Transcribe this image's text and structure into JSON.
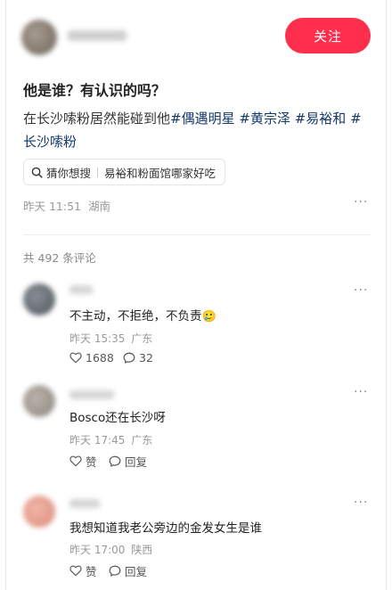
{
  "post": {
    "follow_label": "关注",
    "title": "他是谁？有认识的吗？",
    "body_line1": "在长沙嗦粉居然能碰到他",
    "tags": [
      "#偶遇明星",
      "#黄宗泽",
      "#易裕和",
      "#长沙嗦粉"
    ],
    "search_prefix": "猜你想搜",
    "search_query": "易裕和粉面馆哪家好吃",
    "date": "昨天 11:51",
    "location": "湖南",
    "more": "···"
  },
  "comments_header": "共 492 条评论",
  "comments": [
    {
      "text": "不主动，不拒绝，不负责",
      "emoji": "🥲",
      "date": "昨天 15:35",
      "location": "广东",
      "likes": "1688",
      "replies": "32",
      "more": "···"
    },
    {
      "text": "Bosco还在长沙呀",
      "date": "昨天 17:45",
      "location": "广东",
      "likes": "赞",
      "replies": "回复",
      "more": "···"
    },
    {
      "text": "我想知道我老公旁边的金发女生是谁",
      "date": "昨天 17:00",
      "location": "陕西",
      "likes": "赞",
      "replies": "回复",
      "more": "···"
    }
  ],
  "colors": {
    "accent": "#ff2e4d",
    "tag": "#13386c",
    "muted": "#999999"
  }
}
